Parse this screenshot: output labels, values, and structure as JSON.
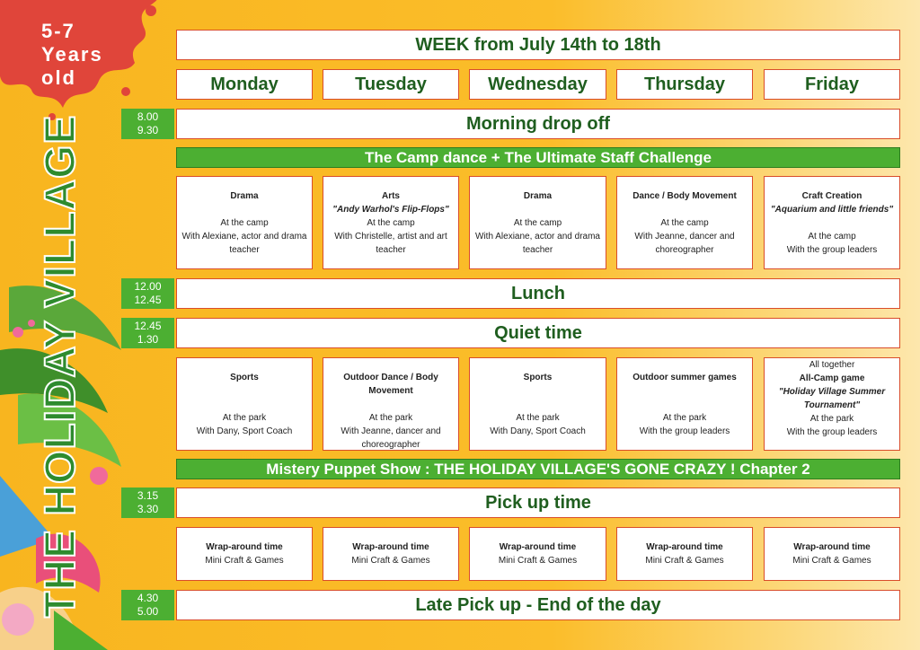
{
  "age_badge": [
    "5-7",
    "Years",
    "old"
  ],
  "side_title": "THE HOLIDAY VILLAGE",
  "week_title": "WEEK from July 14th to 18th",
  "days": [
    "Monday",
    "Tuesday",
    "Wednesday",
    "Thursday",
    "Friday"
  ],
  "slots": {
    "morning": {
      "time": [
        "8.00",
        "9.30"
      ],
      "label": "Morning drop off"
    },
    "camp_dance": "The Camp dance + The Ultimate Staff Challenge",
    "lunch": {
      "time": [
        "12.00",
        "12.45"
      ],
      "label": "Lunch"
    },
    "quiet": {
      "time": [
        "12.45",
        "1.30"
      ],
      "label": "Quiet time"
    },
    "puppet": "Mistery Puppet Show : THE HOLIDAY VILLAGE'S GONE CRAZY ! Chapter 2",
    "pickup": {
      "time": [
        "3.15",
        "3.30"
      ],
      "label": "Pick up time"
    },
    "late": {
      "time": [
        "4.30",
        "5.00"
      ],
      "label": "Late Pick up - End of the day"
    }
  },
  "morning_activities": [
    {
      "title": "Drama",
      "subtitle": "",
      "place": "At the camp",
      "with": "With Alexiane, actor and drama teacher"
    },
    {
      "title": "Arts",
      "subtitle": "\"Andy Warhol's Flip-Flops\"",
      "place": "At the camp",
      "with": "With Christelle, artist and art teacher"
    },
    {
      "title": "Drama",
      "subtitle": "",
      "place": "At the camp",
      "with": "With Alexiane, actor and drama teacher"
    },
    {
      "title": "Dance / Body Movement",
      "subtitle": "",
      "place": "At the camp",
      "with": "With Jeanne, dancer and choreographer"
    },
    {
      "title": "Craft Creation",
      "subtitle": "\"Aquarium and little friends\"",
      "place": "At the camp",
      "with": "With the group leaders"
    }
  ],
  "afternoon_activities": [
    {
      "pre": "",
      "title": "Sports",
      "subtitle": "",
      "place": "At the park",
      "with": "With Dany, Sport Coach"
    },
    {
      "pre": "",
      "title": "Outdoor Dance / Body Movement",
      "subtitle": "",
      "place": "At the park",
      "with": "With Jeanne, dancer and choreographer"
    },
    {
      "pre": "",
      "title": "Sports",
      "subtitle": "",
      "place": "At the park",
      "with": "With Dany, Sport Coach"
    },
    {
      "pre": "",
      "title": "Outdoor summer games",
      "subtitle": "",
      "place": "At the park",
      "with": "With the group leaders"
    },
    {
      "pre": "All together",
      "title": "All-Camp game",
      "subtitle": "\"Holiday Village Summer Tournament\"",
      "place": "At the park",
      "with": "With the group leaders"
    }
  ],
  "wrap_activities": [
    {
      "title": "Wrap-around time",
      "detail": "Mini Craft & Games"
    },
    {
      "title": "Wrap-around time",
      "detail": "Mini Craft & Games"
    },
    {
      "title": "Wrap-around time",
      "detail": "Mini Craft & Games"
    },
    {
      "title": "Wrap-around time",
      "detail": "Mini Craft & Games"
    },
    {
      "title": "Wrap-around time",
      "detail": "Mini Craft & Games"
    }
  ],
  "colors": {
    "accent_red": "#e0453a",
    "green": "#4caf32",
    "dark_green": "#1f5e1f",
    "background": "#f8b51f"
  }
}
